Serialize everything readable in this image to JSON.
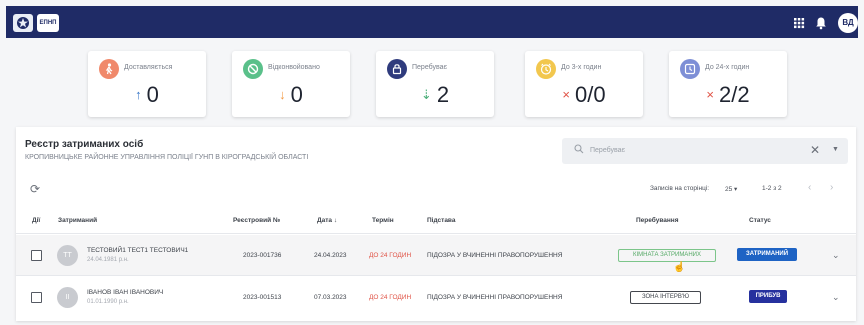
{
  "topbar": {
    "logo_text": "ЕПНП",
    "user_initials": "ВД",
    "icons": [
      "grid-icon",
      "bell-icon"
    ],
    "background": "#1f2b66"
  },
  "stats": [
    {
      "label": "Доставляється",
      "arrow": "↑",
      "value": "0",
      "icon": "walk-icon",
      "color": "#f0896b",
      "arrow_color": "#3a78c9"
    },
    {
      "label": "Відконвойовано",
      "arrow": "↓",
      "value": "0",
      "icon": "ban-icon",
      "color": "#5ac08a",
      "arrow_color": "#f29a46"
    },
    {
      "label": "Перебуває",
      "arrow": "⇣",
      "value": "2",
      "icon": "lock-icon",
      "color": "#2f3b7d",
      "arrow_color": "#4caf7a"
    },
    {
      "label": "До 3-х годин",
      "arrow": "×",
      "value": "0/0",
      "icon": "alarm-icon",
      "color": "#f2c74e",
      "arrow_color": "#e05346"
    },
    {
      "label": "До 24-х годин",
      "arrow": "×",
      "value": "2/2",
      "icon": "clock-icon",
      "color": "#7e8fd6",
      "arrow_color": "#e05346"
    }
  ],
  "panel": {
    "title": "Реєстр затриманих осіб",
    "subtitle": "КРОПИВНИЦЬКЕ РАЙОННЕ УПРАВЛІННЯ ПОЛІЦІЇ ГУНП В КІРОГРАДСЬКІЙ ОБЛАСТІ",
    "search_placeholder": "Перебуває",
    "per_page_label": "Записів на сторінці:",
    "per_page_value": "25",
    "range": "1-2 з 2"
  },
  "table": {
    "headers": [
      "Дії",
      "Затриманий",
      "Реєстровий №",
      "Дата",
      "Термін",
      "Підстава",
      "Перебування",
      "Статус"
    ],
    "rows": [
      {
        "initials": "ТТ",
        "name": "ТЕСТОВИЙ1 ТЕСТ1 ТЕСТОВИЧ1",
        "dob": "24.04.1981 р.н.",
        "reg": "2023-001736",
        "date": "24.04.2023",
        "term": "ДО 24 ГОДИН",
        "reason": "ПІДОЗРА У ВЧИНЕННІ ПРАВОПОРУШЕННЯ",
        "location": "КІМНАТА ЗАТРИМАНИХ",
        "status": "ЗАТРИМАНИЙ",
        "status_color": "#1e63c4"
      },
      {
        "initials": "ІІ",
        "name": "ІВАНОВ ІВАН ІВАНОВИЧ",
        "dob": "01.01.1990 р.н.",
        "reg": "2023-001513",
        "date": "07.03.2023",
        "term": "ДО 24 ГОДИН",
        "reason": "ПІДОЗРА У ВЧИНЕННІ ПРАВОПОРУШЕННЯ",
        "location": "ЗОНА ІНТЕРВ'Ю",
        "status": "ПРИБУВ",
        "status_color": "#26319e"
      }
    ]
  }
}
